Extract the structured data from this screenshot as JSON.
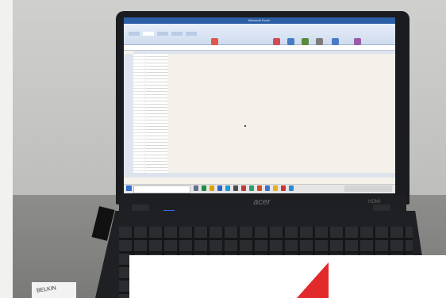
{
  "screen": {
    "window_title": "Microsoft Excel"
  },
  "laptop": {
    "brand_logo": "acer",
    "port_label": "HDMI"
  },
  "desk_item": {
    "box_label": "BELKIN"
  },
  "colors": {
    "ribbon_accent": "#2c5fa5",
    "mark_red": "#e32a2a",
    "led_blue": "#3b6bff"
  }
}
